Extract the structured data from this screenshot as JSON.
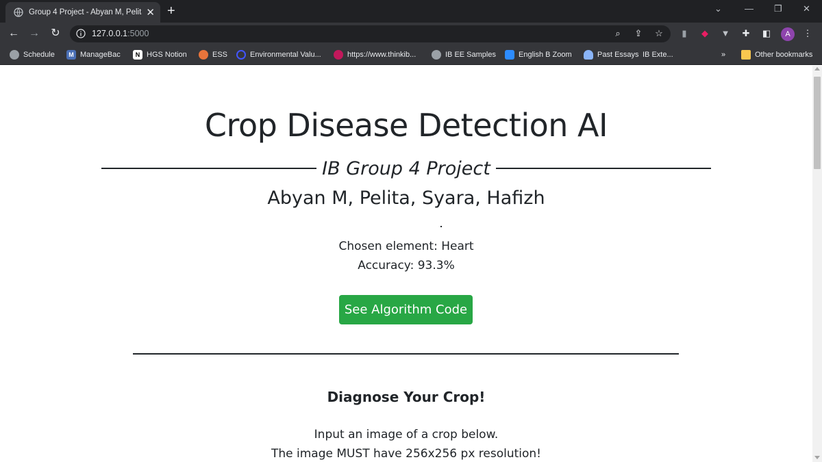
{
  "browser": {
    "tab_title": "Group 4 Project - Abyan M, Pelita",
    "url_host": "127.0.0.1",
    "url_port": ":5000",
    "avatar_initial": "A",
    "bookmarks": [
      {
        "label": "Schedule",
        "icon": "globe-icon",
        "color": "#9aa0a6"
      },
      {
        "label": "ManageBac",
        "icon": "managebac-icon",
        "color": "#4a6fb5"
      },
      {
        "label": "HGS Notion",
        "icon": "notion-icon",
        "color": "#ffffff"
      },
      {
        "label": "ESS",
        "icon": "ess-icon",
        "color": "#e8743b"
      },
      {
        "label": "Environmental Valu...",
        "icon": "quizlet-icon",
        "color": "#4255ff"
      },
      {
        "label": "https://www.thinkib...",
        "icon": "thinkib-icon",
        "color": "#c2185b"
      },
      {
        "label": "IB EE Samples",
        "icon": "globe-icon",
        "color": "#9aa0a6"
      },
      {
        "label": "English B Zoom",
        "icon": "zoom-icon",
        "color": "#2d8cff"
      },
      {
        "label": "Past Essays",
        "icon": "cloud-icon",
        "color": "#8ab4f8"
      },
      {
        "label": "IB Exte...",
        "icon": "none",
        "color": "#35363a"
      }
    ],
    "overflow_label": "»",
    "other_bookmarks": "Other bookmarks"
  },
  "page": {
    "title": "Crop Disease Detection AI",
    "subtitle": "IB Group 4 Project",
    "authors": "Abyan M, Pelita, Syara, Hafizh",
    "chosen_element": "Chosen element: Heart",
    "accuracy": "Accuracy: 93.3%",
    "cta_label": "See Algorithm Code",
    "cta_color": "#28a745",
    "section_title": "Diagnose Your Crop!",
    "instruction_1": "Input an image of a crop below.",
    "instruction_2": "The image MUST have 256x256 px resolution!"
  }
}
